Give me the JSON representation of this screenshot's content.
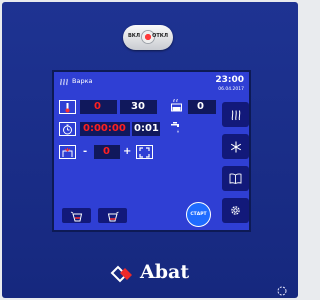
{
  "switch": {
    "on_label": "ВКЛ",
    "off_label": "ОТКЛ"
  },
  "screen": {
    "mode_title": "Варка",
    "time": "23:00",
    "date": "06.04.2017",
    "row1": {
      "actual_temp": "0",
      "set_temp": "30",
      "steam_value": "0"
    },
    "row2": {
      "elapsed": "0:00:00",
      "set_time": "0:01"
    },
    "row3": {
      "minus": "-",
      "level": "0",
      "plus": "+"
    },
    "start_label": "СТАРТ"
  },
  "brand": {
    "name": "Abat"
  },
  "colors": {
    "panel": "#1e3392",
    "screen": "#2f3fd4",
    "accent_red": "#ff2020",
    "start": "#1f6cff"
  },
  "icons": [
    "power-knob-icon",
    "steam-icon",
    "thermometer-icon",
    "pot-icon",
    "stopwatch-icon",
    "water-tap-icon",
    "fan-icon",
    "expand-icon",
    "snowflake-icon",
    "book-icon",
    "gear-icon",
    "cup-down-icon",
    "cup-up-icon",
    "rotate-icon"
  ]
}
